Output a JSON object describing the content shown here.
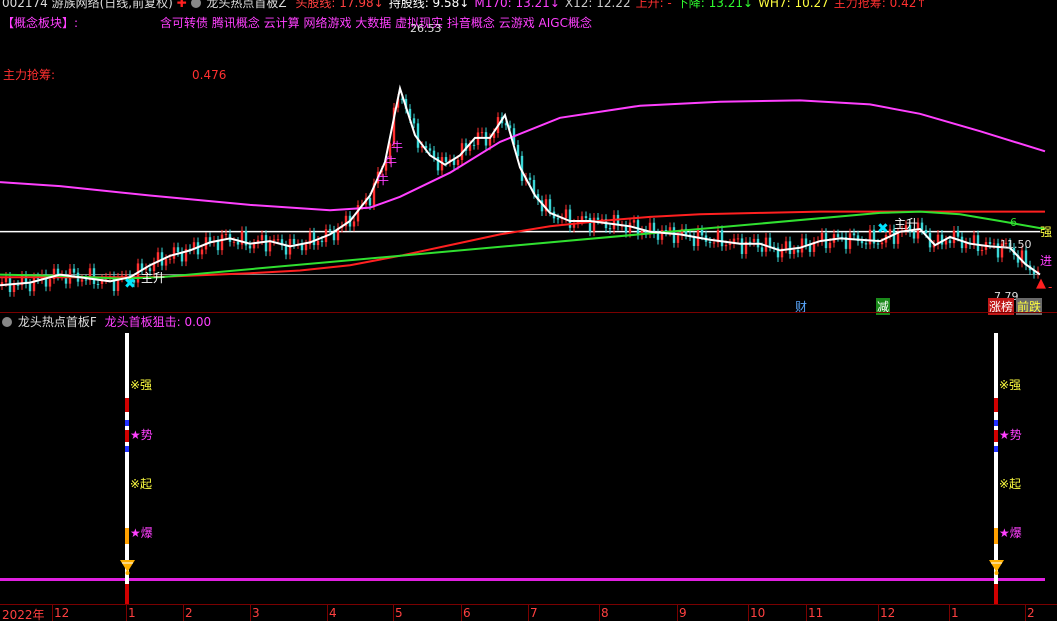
{
  "header": {
    "stock": "002174 游族网络(日线,前复权)",
    "indicator": "龙头热点首板Z",
    "items": [
      {
        "label": "头股线:",
        "value": "17.98",
        "arrow": "↓",
        "color": "#ff4040"
      },
      {
        "label": "持股线:",
        "value": "9.58",
        "arrow": "↓",
        "color": "#ffffff"
      },
      {
        "label": "M170:",
        "value": "13.21",
        "arrow": "↓",
        "color": "#ff40ff"
      },
      {
        "label": "X12:",
        "value": "12.22",
        "arrow": "",
        "color": "#cccccc"
      },
      {
        "label": "上升:",
        "value": "-",
        "arrow": "",
        "color": "#ff3030"
      },
      {
        "label": "下降:",
        "value": "13.21",
        "arrow": "↓",
        "color": "#30ff30"
      },
      {
        "label": "WH7:",
        "value": "10.27",
        "arrow": "",
        "color": "#ffff40"
      },
      {
        "label": "主力抢筹:",
        "value": "0.42",
        "arrow": "↑",
        "color": "#ff3030"
      }
    ]
  },
  "concept": {
    "label": "【概念板块】:",
    "tags": "含可转债 腾讯概念 云计算 网络游戏 大数据 虚拟现实 抖音概念 云游戏 AIGC概念"
  },
  "main_force": {
    "label": "主力抢筹:",
    "value": "0.476"
  },
  "annotations": {
    "peak": "26.53",
    "low": "7.79",
    "right_val": "11.50",
    "ox1": "牛",
    "ox2": "牛",
    "ox3": "牛",
    "rise1": "主升",
    "rise2": "主升",
    "strong": "强",
    "enter": "进",
    "dash": "-",
    "six": "6"
  },
  "badges": {
    "cai": "财",
    "jian": "减",
    "zhangbang": "涨榜",
    "qiandie": "前跌"
  },
  "sub": {
    "title": "龙头热点首板F",
    "field": "龙头首板狙击:",
    "value": "0.00",
    "labels": [
      "※强",
      "★势",
      "※起",
      "★爆"
    ]
  },
  "chart_data": {
    "type": "line",
    "title": "",
    "x_labels": [
      "2022年",
      "12",
      "1",
      "2",
      "3",
      "4",
      "5",
      "6",
      "7",
      "8",
      "9",
      "10",
      "11",
      "12",
      "1",
      "2"
    ],
    "ylim": [
      7,
      27
    ],
    "series": [
      {
        "name": "M170",
        "color": "#ff40ff",
        "x": [
          0,
          60,
          150,
          250,
          330,
          370,
          400,
          450,
          500,
          560,
          640,
          720,
          800,
          870,
          920,
          980,
          1045
        ],
        "values": [
          15.5,
          15.2,
          14.5,
          13.8,
          13.4,
          13.6,
          14.4,
          16.2,
          18.5,
          20.3,
          21.2,
          21.5,
          21.6,
          21.3,
          20.6,
          19.3,
          17.8
        ]
      },
      {
        "name": "持股线",
        "color": "#ffffff",
        "x": [
          0,
          30,
          60,
          90,
          110,
          130,
          150,
          170,
          190,
          210,
          230,
          250,
          270,
          290,
          310,
          330,
          350,
          370,
          385,
          400,
          415,
          430,
          445,
          460,
          475,
          490,
          505,
          520,
          535,
          550,
          570,
          590,
          610,
          630,
          650,
          680,
          710,
          740,
          760,
          780,
          800,
          820,
          840,
          860,
          880,
          900,
          920,
          935,
          950,
          970,
          990,
          1010,
          1025,
          1040
        ],
        "values": [
          7.8,
          8.0,
          8.6,
          8.3,
          8.1,
          8.4,
          9.3,
          10.0,
          10.4,
          11.0,
          11.3,
          10.9,
          11.1,
          10.7,
          11.0,
          11.6,
          12.6,
          14.5,
          17.0,
          22.5,
          19.0,
          17.5,
          16.8,
          17.5,
          18.8,
          18.8,
          20.5,
          16.6,
          14.5,
          13.2,
          12.6,
          12.6,
          12.4,
          12.2,
          11.8,
          11.6,
          11.2,
          10.9,
          10.9,
          10.4,
          10.6,
          11.1,
          11.3,
          11.2,
          11.1,
          11.8,
          12.0,
          10.8,
          11.4,
          10.9,
          10.7,
          10.6,
          9.4,
          8.6
        ]
      },
      {
        "name": "头股线",
        "color": "#ff2020",
        "x": [
          0,
          150,
          250,
          300,
          350,
          400,
          450,
          500,
          550,
          600,
          650,
          700,
          760,
          820,
          880,
          920,
          960,
          1000,
          1045
        ],
        "values": [
          8.4,
          8.4,
          8.7,
          8.9,
          9.3,
          10.0,
          10.8,
          11.6,
          12.2,
          12.6,
          12.9,
          13.1,
          13.2,
          13.3,
          13.3,
          13.3,
          13.3,
          13.3,
          13.3
        ]
      },
      {
        "name": "下降",
        "color": "#30e030",
        "x": [
          0,
          60,
          120,
          160,
          880,
          920,
          960,
          1000,
          1045
        ],
        "values": [
          8.6,
          8.5,
          8.3,
          8.4,
          13.2,
          13.3,
          13.1,
          12.6,
          12.0
        ]
      }
    ],
    "hlines": [
      {
        "value": 11.8,
        "color": "#ffffff"
      },
      {
        "value": 8.6,
        "color": "#888888"
      }
    ]
  }
}
